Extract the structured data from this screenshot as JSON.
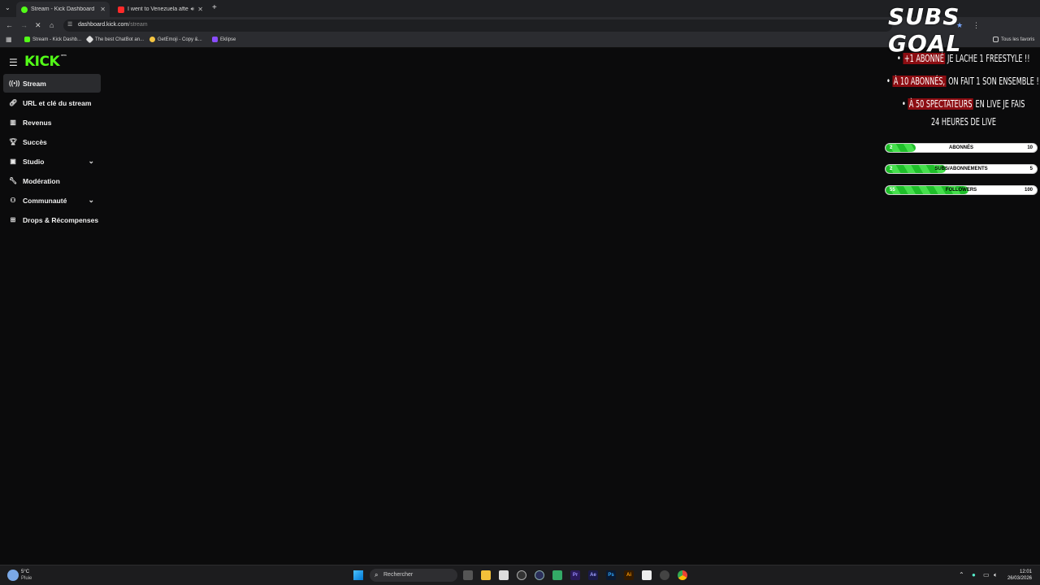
{
  "browser": {
    "tabs": [
      {
        "title": "Stream - Kick Dashboard",
        "active": true
      },
      {
        "title": "I went to Venezuela after M",
        "active": false
      }
    ],
    "url_host": "dashboard.kick.com",
    "url_path": "/stream",
    "bookmarks": [
      "Stream - Kick Dashb...",
      "The best ChatBot an...",
      "GetEmoji - Copy &...",
      "Eklipse"
    ],
    "all_bookmarks": "Tous les favoris"
  },
  "kick": {
    "logo": "KICK",
    "logo_badge": "BETA",
    "nav": [
      {
        "label": "Stream",
        "icon": "broadcast-icon",
        "active": true,
        "expandable": false
      },
      {
        "label": "URL et clé du stream",
        "icon": "link-icon",
        "active": false,
        "expandable": false
      },
      {
        "label": "Revenus",
        "icon": "chart-icon",
        "active": false,
        "expandable": false
      },
      {
        "label": "Succès",
        "icon": "trophy-icon",
        "active": false,
        "expandable": false
      },
      {
        "label": "Studio",
        "icon": "studio-icon",
        "active": false,
        "expandable": true
      },
      {
        "label": "Modération",
        "icon": "wrench-icon",
        "active": false,
        "expandable": false
      },
      {
        "label": "Communauté",
        "icon": "community-icon",
        "active": false,
        "expandable": true
      },
      {
        "label": "Drops & Récompenses",
        "icon": "gift-icon",
        "active": false,
        "expandable": false
      }
    ]
  },
  "overlay": {
    "title": "SUBS GOAL",
    "goals": [
      {
        "highlight": "+1 ABONNÉ",
        "rest": " JE LACHE 1 FREESTYLE !!"
      },
      {
        "highlight": "À 10 ABONNÉS,",
        "rest": " ON FAIT 1 SON ENSEMBLE !!"
      },
      {
        "highlight": "À 50 SPECTATEURS",
        "rest": " EN LIVE JE FAIS"
      }
    ],
    "goal_tail": "24 HEURES DE LIVE",
    "bars": [
      {
        "label": "ABONNÉS",
        "current": "2",
        "max": "10",
        "progress": 0.2
      },
      {
        "label": "SUBS/ABONNEMENTS",
        "current": "2",
        "max": "5",
        "progress": 0.4
      },
      {
        "label": "FOLLOWERS",
        "current": "55",
        "max": "100",
        "progress": 0.55
      }
    ],
    "colors": {
      "highlight": "#8c0d12",
      "bar_fill": "#2fcc36"
    }
  },
  "taskbar": {
    "weather_temp": "5°C",
    "weather_desc": "Pluie",
    "search_placeholder": "Rechercher",
    "time": "12:01",
    "date": "26/03/2026"
  }
}
